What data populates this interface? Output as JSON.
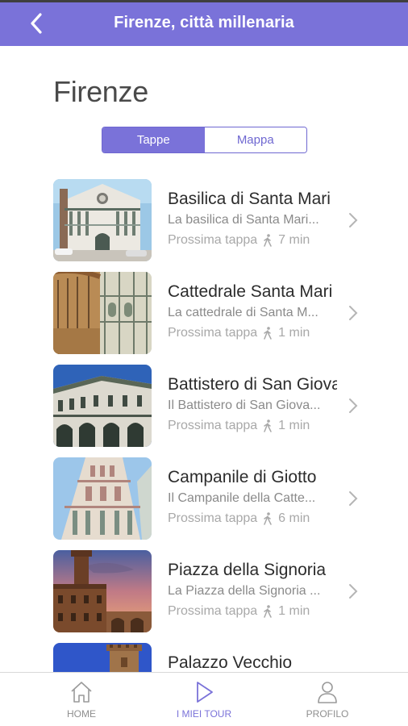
{
  "header": {
    "title": "Firenze, città millenaria",
    "back_icon": "chevron-left-icon",
    "color": "#7a72d9"
  },
  "page_title": "Firenze",
  "segments": {
    "tappe": "Tappe",
    "mappa": "Mappa",
    "selected": "Tappe"
  },
  "next_label": "Prossima tappa",
  "stops": [
    {
      "name": "Basilica di Santa Mari",
      "desc": "La basilica di Santa Mari...",
      "time": "7 min",
      "image": "basilica-santa-maria-novella"
    },
    {
      "name": "Cattedrale Santa Mari",
      "desc": "La cattedrale di Santa M...",
      "time": "1 min",
      "image": "cattedrale-santa-maria-del-fiore"
    },
    {
      "name": "Battistero di San Giova",
      "desc": "Il Battistero di San Giova...",
      "time": "1 min",
      "image": "battistero-san-giovanni"
    },
    {
      "name": "Campanile di Giotto",
      "desc": "Il Campanile della Catte...",
      "time": "6 min",
      "image": "campanile-giotto"
    },
    {
      "name": "Piazza della Signoria",
      "desc": "La Piazza della Signoria ...",
      "time": "1 min",
      "image": "piazza-signoria"
    },
    {
      "name": "Palazzo Vecchio",
      "desc": "",
      "time": "",
      "image": "palazzo-vecchio"
    }
  ],
  "bottom_nav": {
    "home": "HOME",
    "tours": "I MIEI TOUR",
    "profile": "PROFILO",
    "active": "I MIEI TOUR"
  }
}
